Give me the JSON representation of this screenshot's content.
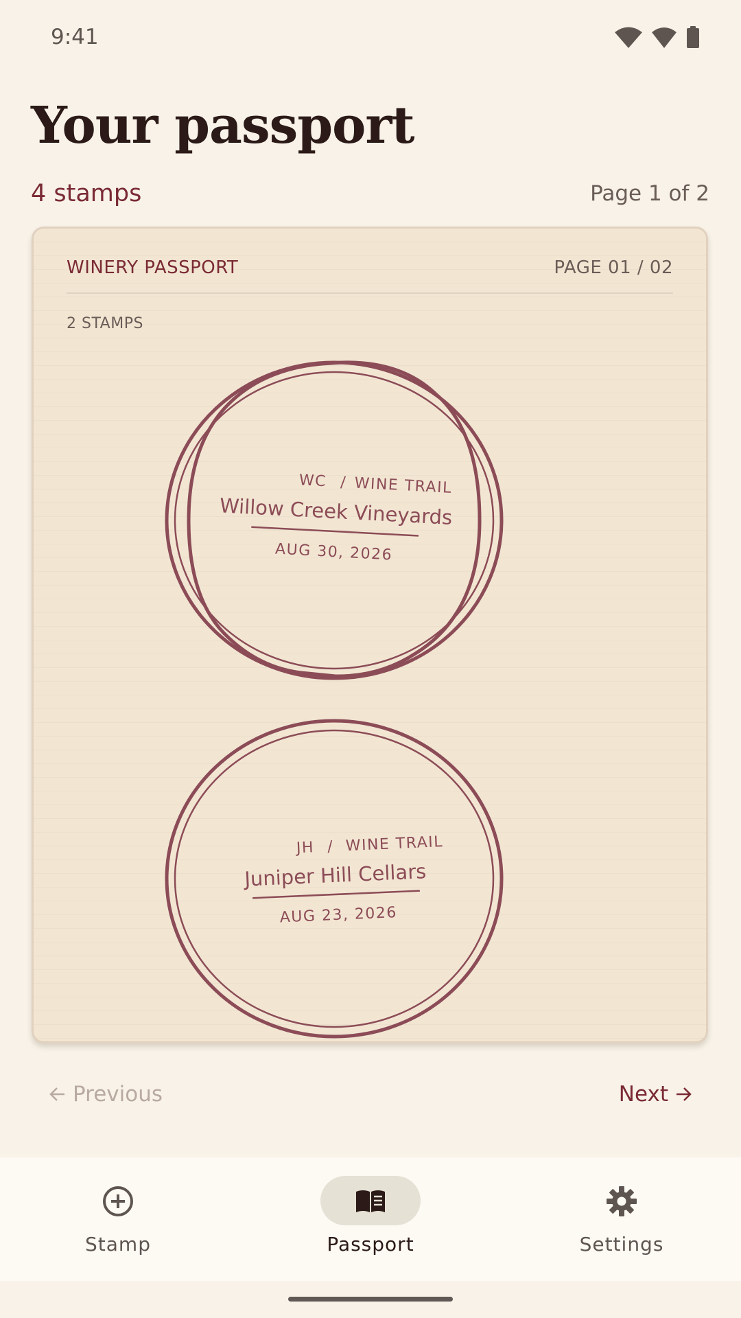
{
  "status_bar": {
    "time": "9:41",
    "icons": [
      "wifi-icon",
      "signal-icon",
      "battery-icon"
    ]
  },
  "header": {
    "title": "Your passport",
    "stamp_count": "4 stamps",
    "page_indicator": "Page 1 of 2"
  },
  "card": {
    "brand": "WINERY PASSPORT",
    "page_label": "PAGE 01 / 02",
    "stamps_label": "2 STAMPS",
    "stamps": [
      {
        "code": "WC",
        "trail": "WINE TRAIL",
        "name": "Willow Creek Vineyards",
        "date": "AUG 30, 2026"
      },
      {
        "code": "JH",
        "trail": "WINE TRAIL",
        "name": "Juniper Hill Cellars",
        "date": "AUG 23, 2026"
      }
    ]
  },
  "pager": {
    "previous": "Previous",
    "next": "Next"
  },
  "bottom_nav": {
    "items": [
      {
        "label": "Stamp",
        "icon": "add-circle-icon",
        "active": false
      },
      {
        "label": "Passport",
        "icon": "book-icon",
        "active": true
      },
      {
        "label": "Settings",
        "icon": "gear-icon",
        "active": false
      }
    ]
  },
  "colors": {
    "accent": "#7a2a34",
    "stamp_ink": "#8c4c57",
    "page_background": "#f8f2e8",
    "card_paper": "#f2e6d3"
  }
}
